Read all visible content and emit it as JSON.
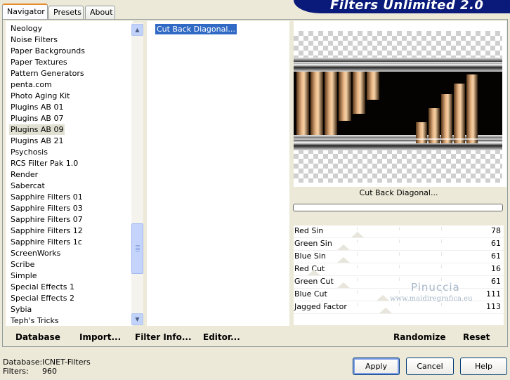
{
  "tabs": [
    "Navigator",
    "Presets",
    "About"
  ],
  "banner_title": "Filters Unlimited 2.0",
  "categories": [
    "Neology",
    "Noise Filters",
    "Paper Backgrounds",
    "Paper Textures",
    "Pattern Generators",
    "penta.com",
    "Photo Aging Kit",
    "Plugins AB 01",
    "Plugins AB 07",
    "Plugins AB 09",
    "Plugins AB 21",
    "Psychosis",
    "RCS Filter Pak 1.0",
    "Render",
    "Sabercat",
    "Sapphire Filters 01",
    "Sapphire Filters 03",
    "Sapphire Filters 07",
    "Sapphire Filters 12",
    "Sapphire Filters 1c",
    "ScreenWorks",
    "Scribe",
    "Simple",
    "Special Effects 1",
    "Special Effects 2",
    "Sybia",
    "Teph's Tricks"
  ],
  "selected_category": "Plugins AB 09",
  "filters": [
    "Cut Back Diagonal..."
  ],
  "filter_name": "Cut Back Diagonal...",
  "sliders": [
    {
      "label": "Red Sin",
      "value": "78"
    },
    {
      "label": "Green Sin",
      "value": "61"
    },
    {
      "label": "Blue Sin",
      "value": "61"
    },
    {
      "label": "Red Cut",
      "value": "16"
    },
    {
      "label": "Green Cut",
      "value": "61"
    },
    {
      "label": "Blue Cut",
      "value": "111"
    },
    {
      "label": "Jagged Factor",
      "value": "113"
    }
  ],
  "watermark": {
    "line1": "Pinuccia",
    "line2": "www.maidiregrafica.eu"
  },
  "bottom_links": {
    "database": "Database",
    "import": "Import...",
    "filter_info": "Filter Info...",
    "editor": "Editor...",
    "randomize": "Randomize",
    "reset": "Reset"
  },
  "status": {
    "database_label": "Database:",
    "database_value": "ICNET-Filters",
    "filters_label": "Filters:",
    "filters_value": "960"
  },
  "buttons": {
    "apply": "Apply",
    "cancel": "Cancel",
    "help": "Help"
  },
  "colors": {
    "selection": "#316ac5",
    "banner": "#0a1a7a",
    "dialog_bg": "#ece9d8"
  }
}
